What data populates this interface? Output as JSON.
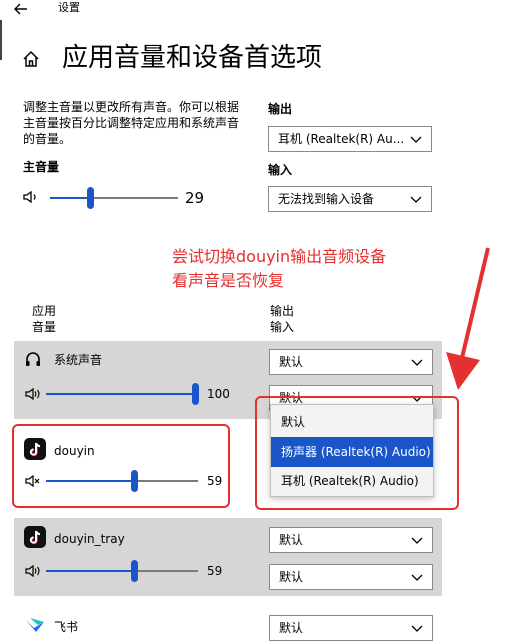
{
  "window": {
    "title": "设置"
  },
  "page": {
    "title": "应用音量和设备首选项"
  },
  "master": {
    "description": "调整主音量以更改所有声音。你可以根据主音量按百分比调整特定应用和系统声音的音量。",
    "label": "主音量",
    "volume": 29,
    "volume_text": "29"
  },
  "output": {
    "label": "输出",
    "value": "耳机 (Realtek(R) Au..."
  },
  "input": {
    "label": "输入",
    "value": "无法找到输入设备"
  },
  "annotation": {
    "line1": "尝试切换douyin输出音频设备",
    "line2": "看声音是否恢复",
    "color": "#e53030"
  },
  "columns": {
    "left_top": "应用",
    "left_bottom": "音量",
    "right_top": "输出",
    "right_bottom": "输入"
  },
  "apps": [
    {
      "name": "系统声音",
      "volume": 100,
      "volume_text": "100",
      "output": "默认",
      "input": "默认"
    },
    {
      "name": "douyin",
      "volume": 59,
      "volume_text": "59",
      "muted": true
    },
    {
      "name": "douyin_tray",
      "volume": 59,
      "volume_text": "59",
      "output": "默认",
      "input": "默认"
    },
    {
      "name": "飞书",
      "output": "默认"
    }
  ],
  "dropdown": {
    "options": [
      "默认",
      "扬声器 (Realtek(R) Audio)",
      "耳机 (Realtek(R) Audio)"
    ],
    "selected_index": 1
  },
  "colors": {
    "accent": "#1b56c9",
    "row_bg": "#d6d6d6",
    "annotation": "#e53030"
  },
  "icons": [
    "back-arrow-icon",
    "home-icon",
    "speaker-icon",
    "headphones-icon",
    "tiktok-icon",
    "muted-speaker-icon",
    "feishu-icon",
    "chevron-down-icon"
  ]
}
